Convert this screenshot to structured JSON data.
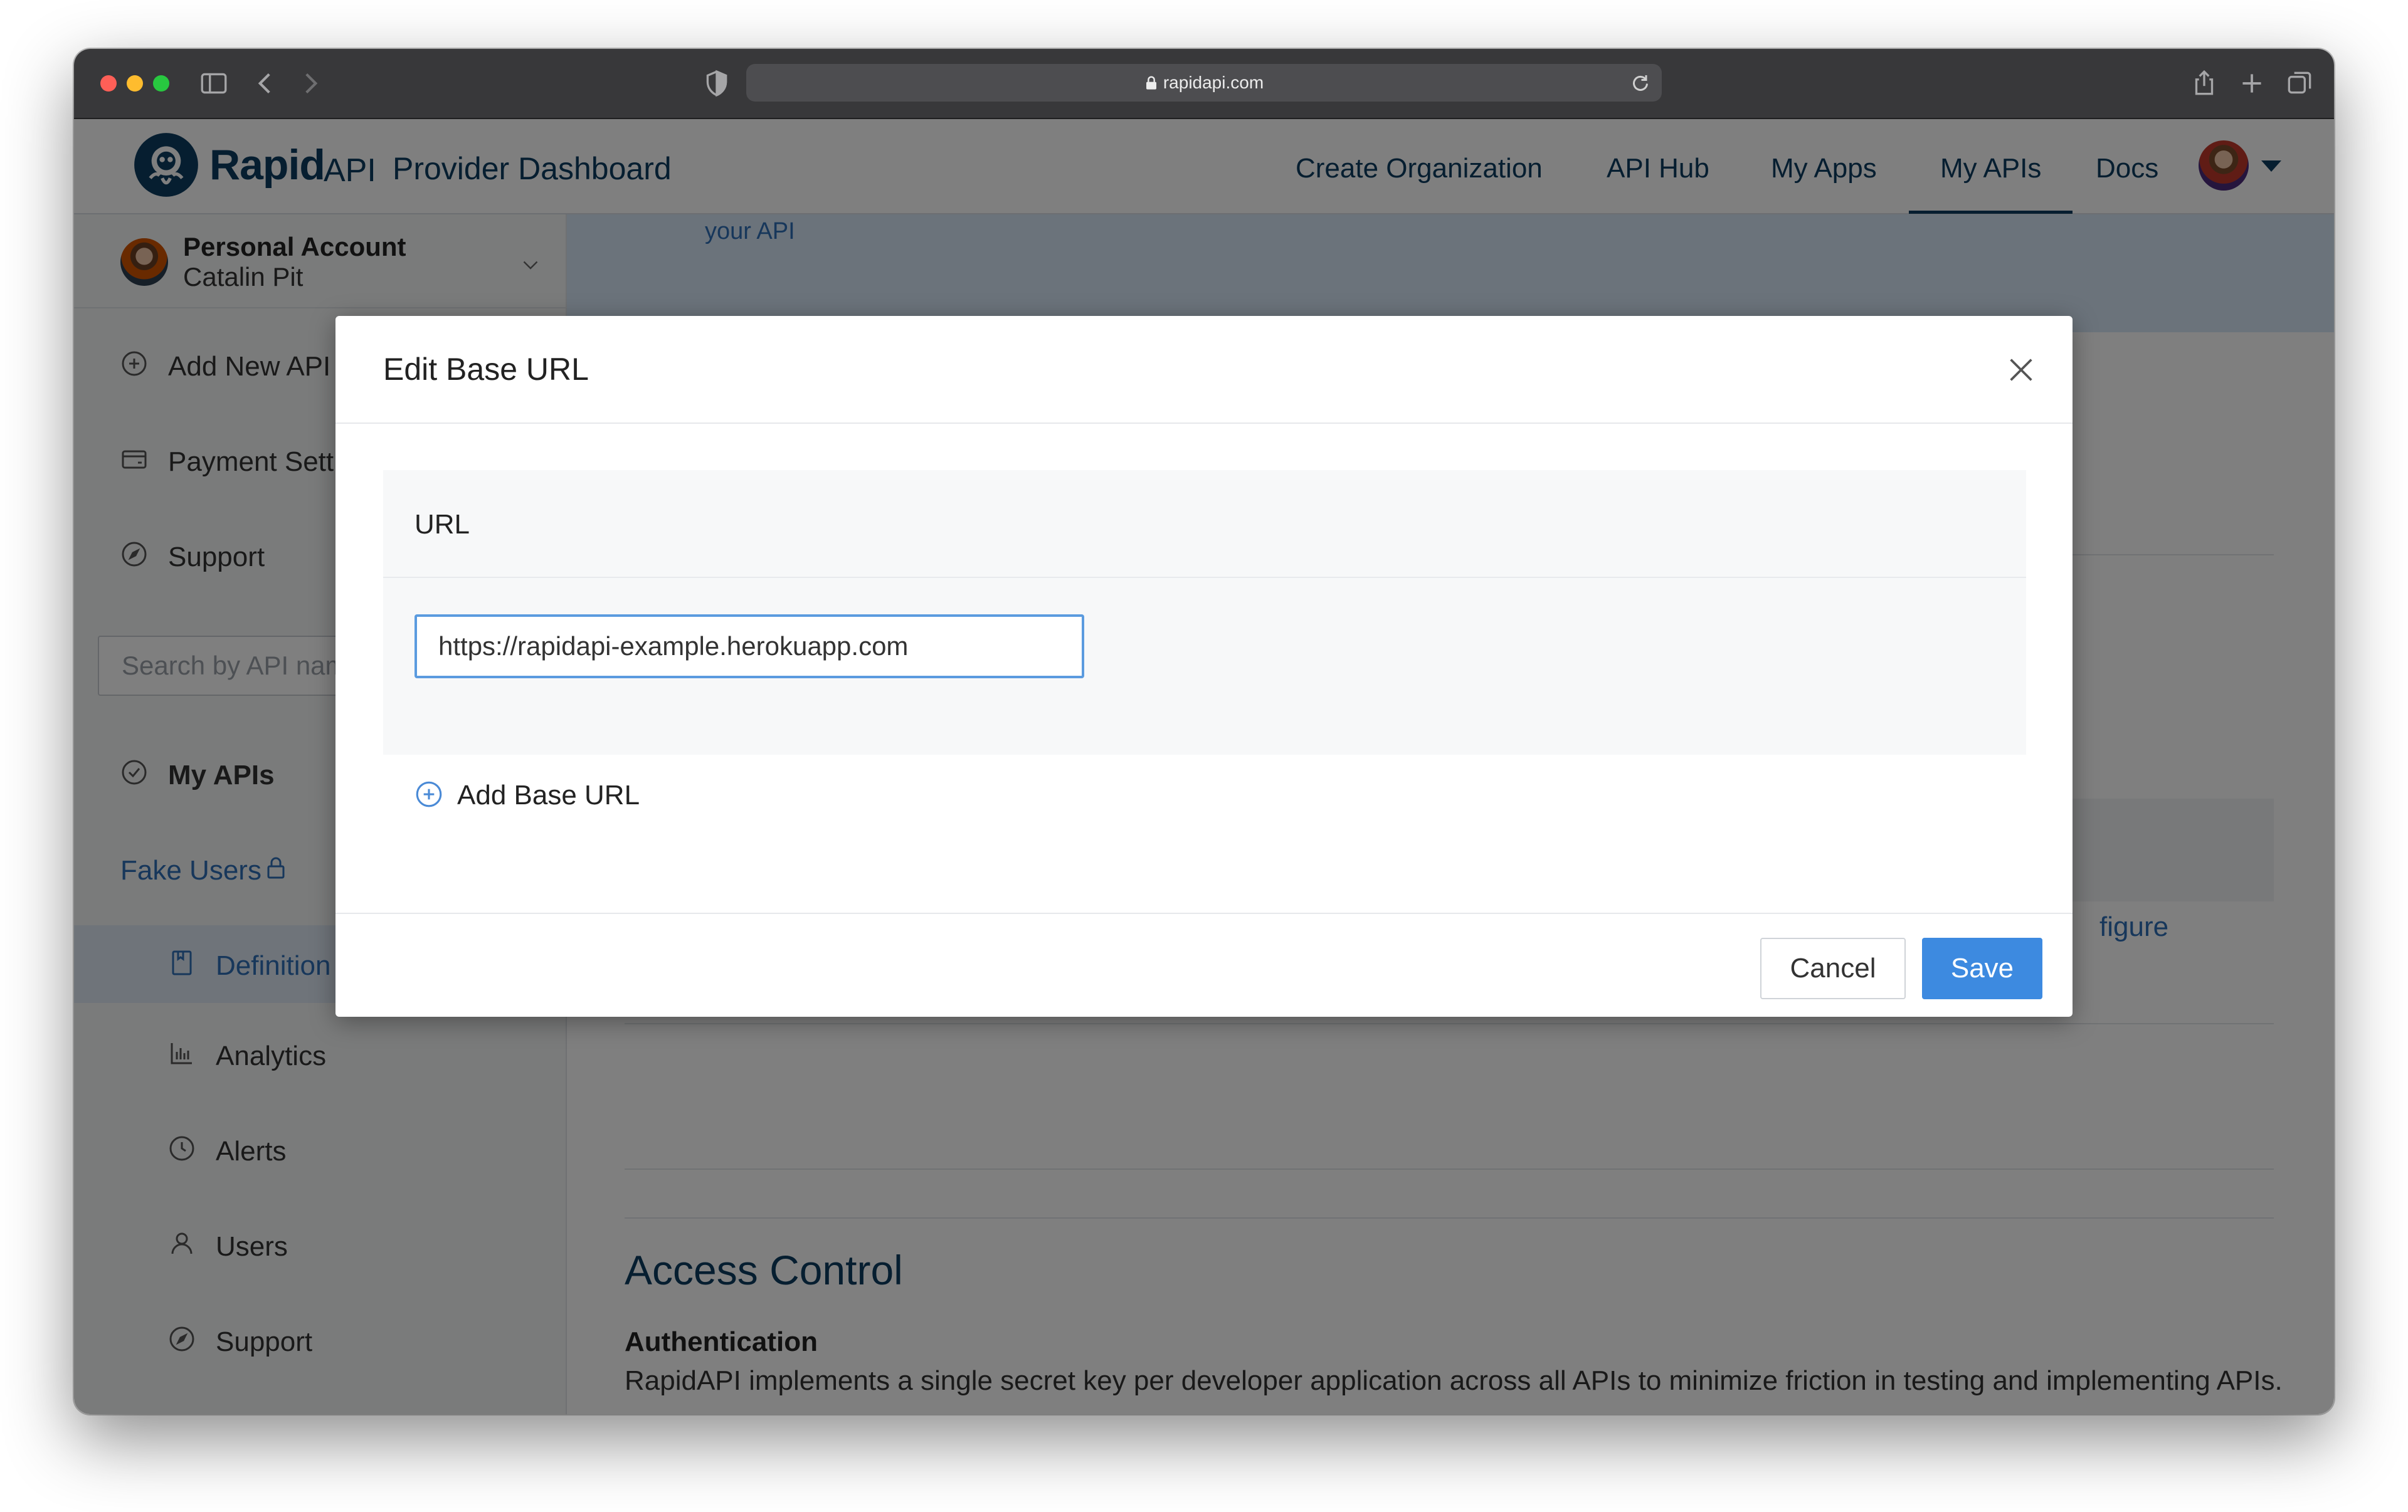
{
  "browser": {
    "url": "rapidapi.com"
  },
  "header": {
    "logo_rapid": "Rapid",
    "logo_api": "API",
    "title": "Provider Dashboard",
    "nav": [
      {
        "label": "Create Organization"
      },
      {
        "label": "API Hub"
      },
      {
        "label": "My Apps"
      },
      {
        "label": "My APIs",
        "active": true
      },
      {
        "label": "Docs"
      }
    ]
  },
  "sidebar": {
    "account_type": "Personal Account",
    "account_name": "Catalin Pit",
    "items": [
      {
        "label": "Add New API",
        "icon": "plus-circle-icon"
      },
      {
        "label": "Payment Settings",
        "icon": "card-icon"
      },
      {
        "label": "Support",
        "icon": "compass-icon"
      }
    ],
    "search_placeholder": "Search by API name",
    "my_apis": "My APIs",
    "api_name": "Fake Users",
    "api_items": [
      {
        "label": "Definition",
        "icon": "book-icon",
        "active": true
      },
      {
        "label": "Analytics",
        "icon": "bar-chart-icon"
      },
      {
        "label": "Alerts",
        "icon": "clock-icon"
      },
      {
        "label": "Users",
        "icon": "user-icon"
      },
      {
        "label": "Support",
        "icon": "compass-icon"
      }
    ]
  },
  "main": {
    "banner_link": "your API",
    "partial_link": "figure",
    "access_control_heading": "Access Control",
    "authentication_heading": "Authentication",
    "authentication_text": "RapidAPI implements a single secret key per developer application across all APIs to minimize friction in testing and implementing APIs."
  },
  "modal": {
    "title": "Edit Base URL",
    "url_label": "URL",
    "url_value": "https://rapidapi-example.herokuapp.com",
    "add_base_url": "Add Base URL",
    "cancel_label": "Cancel",
    "save_label": "Save"
  },
  "colors": {
    "brand": "#0c3c60",
    "link": "#2e6fb6",
    "primary_button": "#3d8ae0",
    "input_focus": "#5b9bdf"
  }
}
